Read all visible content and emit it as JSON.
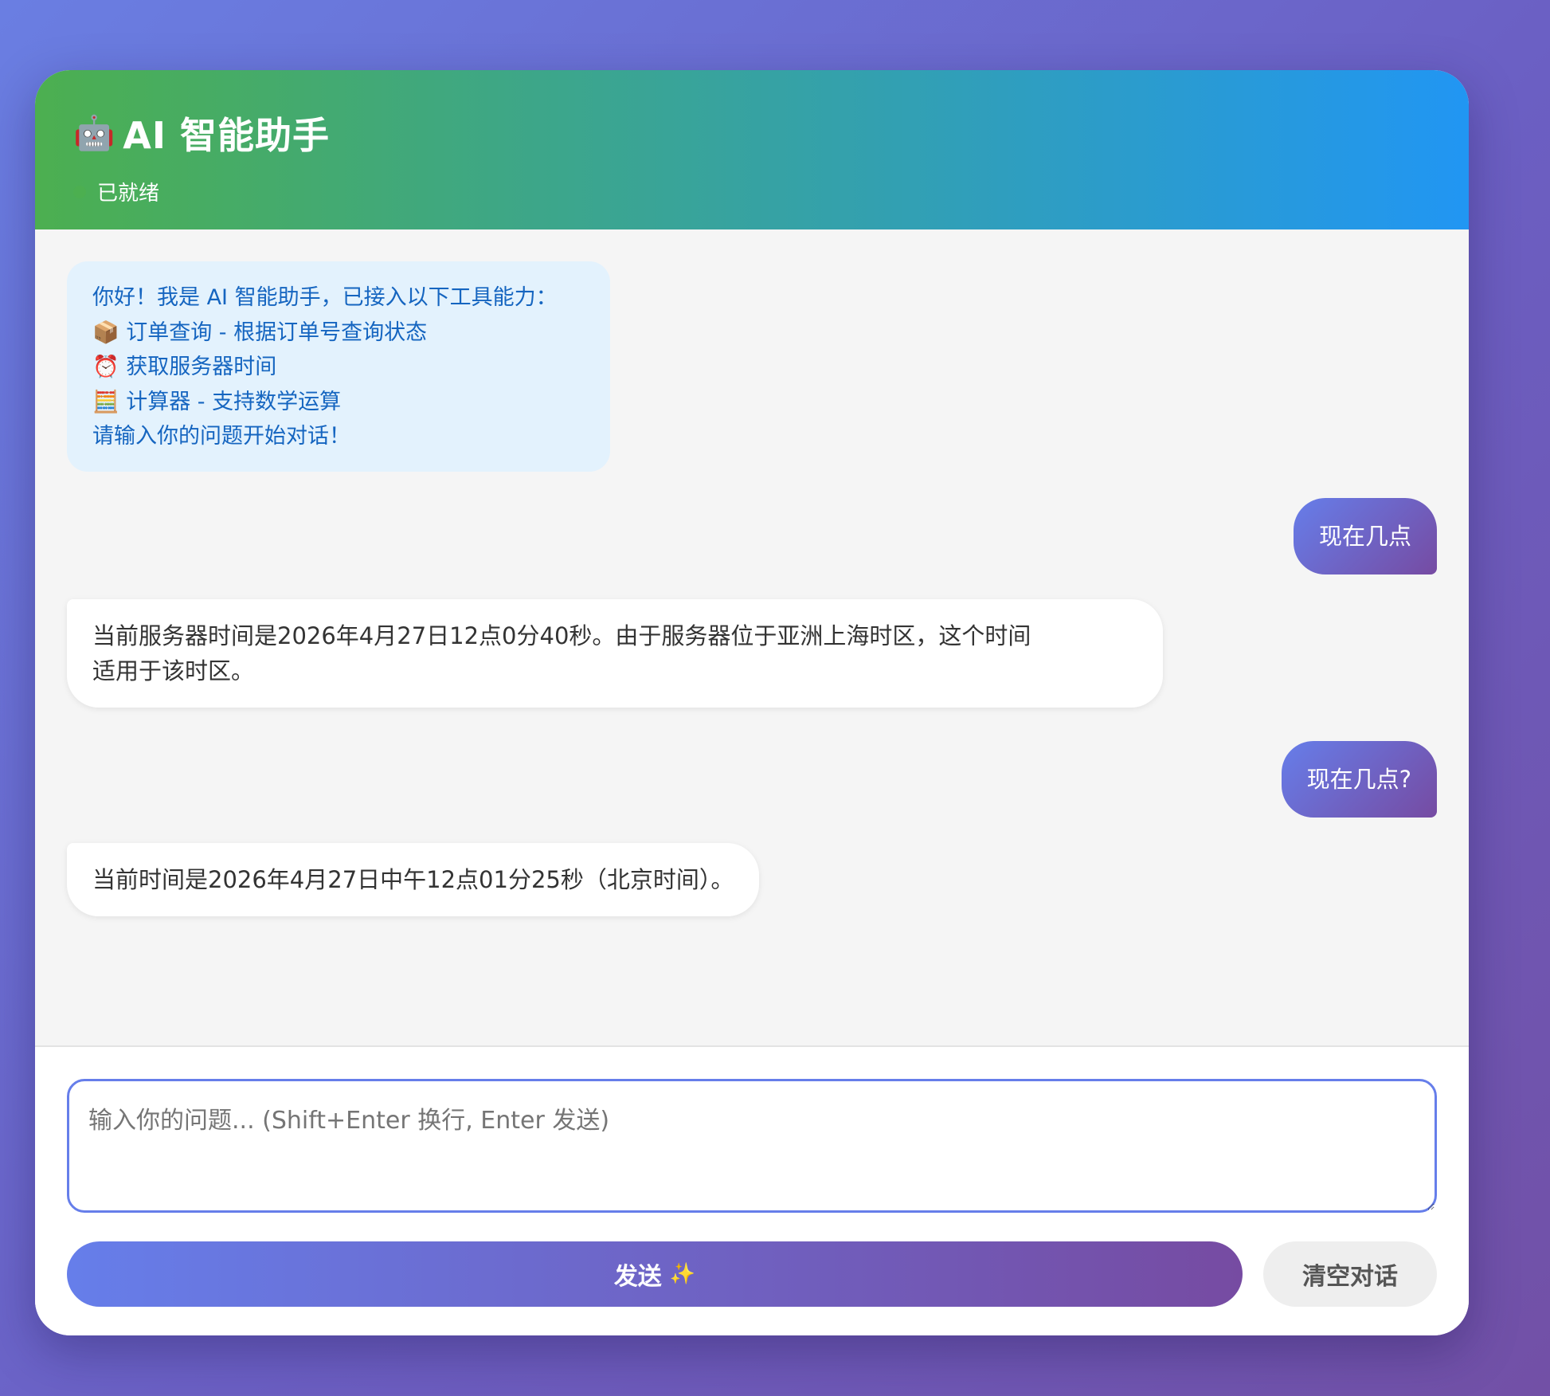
{
  "header": {
    "icon": "robot-icon",
    "icon_glyph": "🤖",
    "title": "AI 智能助手",
    "status": "已就绪",
    "status_color": "#4caf50"
  },
  "messages": {
    "welcome": {
      "lines": [
        "你好！我是 AI 智能助手，已接入以下工具能力：",
        "📦 订单查询 - 根据订单号查询状态",
        "⏰ 获取服务器时间",
        "🧮 计算器 - 支持数学运算",
        "请输入你的问题开始对话！"
      ]
    },
    "user_1": "现在几点",
    "bot_1": {
      "lines": [
        "当前服务器时间是2026年4月27日12点0分40秒。由于服务器位于亚洲上海时区，这个时间",
        "适用于该时区。"
      ]
    },
    "user_2": "现在几点?",
    "bot_2": "当前时间是2026年4月27日中午12点01分25秒（北京时间）。"
  },
  "input": {
    "placeholder": "输入你的问题... (Shift+Enter 换行, Enter 发送)",
    "value": ""
  },
  "buttons": {
    "send_label": "发送",
    "send_icon": "sparkle-icon",
    "send_icon_glyph": "✨",
    "clear_label": "清空对话"
  },
  "colors": {
    "header_gradient_start": "#4caf50",
    "header_gradient_end": "#2196f3",
    "accent_start": "#667eea",
    "accent_end": "#764ba2",
    "welcome_bg": "#e3f2fd",
    "welcome_text": "#1565c0"
  }
}
